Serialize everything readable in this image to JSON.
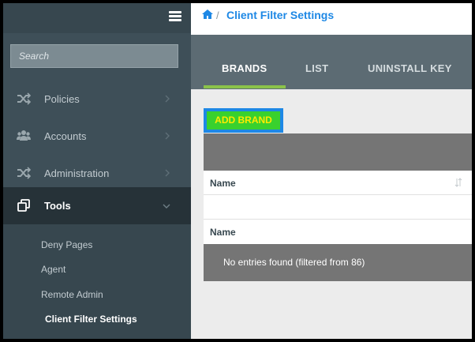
{
  "sidebar": {
    "search_placeholder": "Search",
    "nav": [
      {
        "label": "Policies",
        "icon": "shuffle-icon"
      },
      {
        "label": "Accounts",
        "icon": "users-icon"
      },
      {
        "label": "Administration",
        "icon": "shuffle-icon"
      },
      {
        "label": "Tools",
        "icon": "clone-icon"
      }
    ],
    "submenu": [
      "Deny Pages",
      "Agent",
      "Remote Admin",
      "Client Filter Settings"
    ]
  },
  "header": {
    "separator": "/",
    "title": "Client Filter Settings"
  },
  "tabs": [
    {
      "label": "BRANDS",
      "active": true
    },
    {
      "label": "LIST",
      "active": false
    },
    {
      "label": "UNINSTALL KEY",
      "active": false
    }
  ],
  "content": {
    "add_button": "ADD BRAND",
    "table": {
      "header": "Name",
      "footer": "Name",
      "empty_message": "No entries found (filtered from 86)"
    }
  },
  "colors": {
    "accent": "#1e88e5",
    "tab_indicator": "#8bc34a",
    "button_fill": "#39d12e",
    "button_text": "#ffea00"
  }
}
